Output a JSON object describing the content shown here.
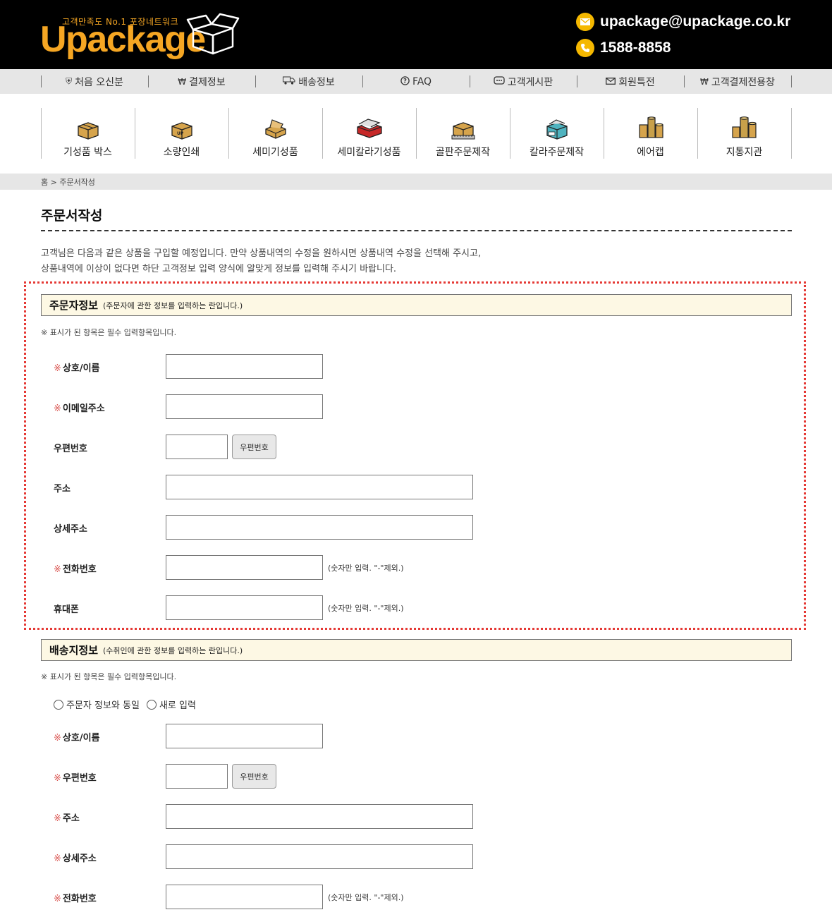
{
  "header": {
    "logo_tagline": "고객만족도 No.1  포장네트워크",
    "logo_text": "Upackage",
    "email": "upackage@upackage.co.kr",
    "phone": "1588-8858",
    "colors": {
      "brand": "#f5a623",
      "header_bg": "#000000",
      "contact_icon": "#f5b800"
    }
  },
  "top_menu": [
    {
      "label": "처음 오신분",
      "icon": "shield-icon"
    },
    {
      "label": "결제정보",
      "icon": "won-circle-icon"
    },
    {
      "label": "배송정보",
      "icon": "truck-icon"
    },
    {
      "label": "FAQ",
      "icon": "question-circle-icon"
    },
    {
      "label": "고객게시판",
      "icon": "chat-icon"
    },
    {
      "label": "회원특전",
      "icon": "envelope-icon"
    },
    {
      "label": "고객결제전용창",
      "icon": "won-circle-icon"
    }
  ],
  "categories": [
    {
      "label": "기성품 박스",
      "icon": "box-icon"
    },
    {
      "label": "소량인쇄",
      "icon": "printed-box-icon"
    },
    {
      "label": "세미기성품",
      "icon": "open-box-icon"
    },
    {
      "label": "세미칼라기성품",
      "icon": "color-box-icon"
    },
    {
      "label": "골판주문제작",
      "icon": "ruler-box-icon"
    },
    {
      "label": "칼라주문제작",
      "icon": "custom-color-box-icon"
    },
    {
      "label": "에어캡",
      "icon": "air-cap-roll-icon"
    },
    {
      "label": "지통지관",
      "icon": "paper-tube-icon"
    }
  ],
  "breadcrumb": "홈 > 주문서작성",
  "page_title": "주문서작성",
  "intro": {
    "line1": "고객님은 다음과 같은 상품을 구입할 예정입니다. 만약 상품내역의 수정을 원하시면 상품내역 수정을 선택해 주시고,",
    "line2": "상품내역에 이상이 없다면 하단 고객정보 입력 양식에 알맞게 정보를 입력해 주시기 바랍니다."
  },
  "orderer": {
    "title": "주문자정보",
    "subtitle": "(주문자에 관한 정보를 입력하는 란입니다.)",
    "note": "※ 표시가 된 항목은 필수 입력항목입니다.",
    "required_mark": "※",
    "name_label": "상호/이름",
    "email_label": "이메일주소",
    "zip_label": "우편번호",
    "zip_button": "우편번호",
    "address_label": "주소",
    "address_detail_label": "상세주소",
    "phone_label": "전화번호",
    "phone_hint": "(숫자만 입력. \"-\"제외.)",
    "mobile_label": "휴대폰",
    "mobile_hint": "(숫자만 입력. \"-\"제외.)"
  },
  "shipping": {
    "title": "배송지정보",
    "subtitle": "(수취인에 관한 정보를 입력하는 란입니다.)",
    "note": "※ 표시가 된 항목은 필수 입력항목입니다.",
    "required_mark": "※",
    "radio_same": "주문자 정보와 동일",
    "radio_new": "새로 입력",
    "name_label": "상호/이름",
    "zip_label": "우편번호",
    "zip_button": "우편번호",
    "address_label": "주소",
    "address_detail_label": "상세주소",
    "phone_label": "전화번호",
    "phone_hint": "(숫자만 입력. \"-\"제외.)"
  }
}
